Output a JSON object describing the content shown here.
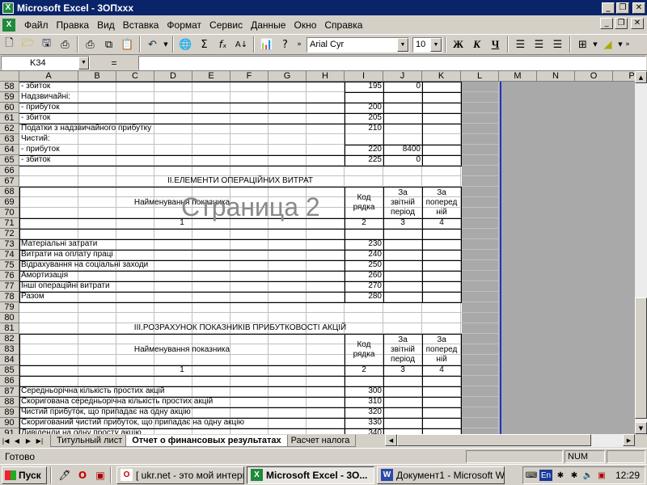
{
  "window": {
    "title": "Microsoft Excel - 3ОПххх"
  },
  "menu": {
    "items": [
      "Файл",
      "Правка",
      "Вид",
      "Вставка",
      "Формат",
      "Сервис",
      "Данные",
      "Окно",
      "Справка"
    ]
  },
  "toolbar": {
    "font_name": "Arial Cyr",
    "font_size": "10",
    "bold_label": "Ж",
    "italic_label": "К",
    "underline_label": "Ч"
  },
  "formula_bar": {
    "cell_ref": "K34",
    "equals": "=",
    "value": ""
  },
  "columns": [
    "A",
    "B",
    "C",
    "D",
    "E",
    "F",
    "G",
    "H",
    "I",
    "J",
    "K",
    "L",
    "M",
    "N",
    "O",
    "P"
  ],
  "rows": [
    "58",
    "59",
    "60",
    "61",
    "62",
    "63",
    "64",
    "65",
    "66",
    "67",
    "68",
    "69",
    "70",
    "71",
    "72",
    "73",
    "74",
    "75",
    "76",
    "77",
    "78",
    "79",
    "80",
    "81",
    "82",
    "83",
    "84",
    "85",
    "86",
    "87",
    "88",
    "89",
    "90",
    "91"
  ],
  "cells": {
    "r58_a": "- збиток",
    "r58_i": "195",
    "r58_j": "0",
    "r59_a": "Надзвичайні:",
    "r60_a": "- прибуток",
    "r60_i": "200",
    "r61_a": "- збиток",
    "r61_i": "205",
    "r62_a": "Податки з надзвичайного прибутку",
    "r62_i": "210",
    "r63_a": "Чистий:",
    "r64_a": "- прибуток",
    "r64_i": "220",
    "r64_j": "8400",
    "r65_a": "- збиток",
    "r65_i": "225",
    "r65_j": "0",
    "section2_title": "II.ЕЛЕМЕНТИ ОПЕРАЦІЙНИХ ВИТРАТ",
    "h1_name": "Найменування показника",
    "h1_code": [
      "Код",
      "рядка"
    ],
    "h1_period": [
      "За",
      "звітній",
      "період"
    ],
    "h1_prev": [
      "За",
      "поперед",
      "ній"
    ],
    "r71_a": "1",
    "r71_i": "2",
    "r71_j": "3",
    "r71_k": "4",
    "r73_a": "Матеріальні затрати",
    "r73_i": "230",
    "r74_a": "Витрати на оплату праці",
    "r74_i": "240",
    "r75_a": "Відрахування на соціальні заходи",
    "r75_i": "250",
    "r76_a": "Амортизація",
    "r76_i": "260",
    "r77_a": "Інші операційні витрати",
    "r77_i": "270",
    "r78_a": "Разом",
    "r78_i": "280",
    "section3_title": "III.РОЗРАХУНОК ПОКАЗНИКІВ ПРИБУТКОВОСТІ АКЦІЙ",
    "h2_name": "Найменування показника",
    "h2_code": [
      "Код",
      "рядка"
    ],
    "h2_period": [
      "За",
      "звітній",
      "період"
    ],
    "h2_prev": [
      "За",
      "поперед",
      "ній"
    ],
    "r85_a": "1",
    "r85_i": "2",
    "r85_j": "3",
    "r85_k": "4",
    "r87_a": "Середньорічна кількість простих акцій",
    "r87_i": "300",
    "r88_a": "Скоригована середньорічна кількість простих акцій",
    "r88_i": "310",
    "r89_a": "Чистий прибуток, що припадає на одну акцію",
    "r89_i": "320",
    "r90_a": "Скоригований чистий прибуток, що припадає на одну акцію",
    "r90_i": "330",
    "r91_a": "Дивіденди на одну просту акцію",
    "r91_i": "340"
  },
  "watermark": "Страница 2",
  "sheet_tabs": [
    "Титульный лист",
    "Отчет о финансовых результатах",
    "Расчет налога"
  ],
  "active_tab": "Отчет о финансовых результатах",
  "status": {
    "text": "Готово",
    "num": "NUM"
  },
  "taskbar": {
    "start_label": "Пуск",
    "tasks": [
      "[ ukr.net - это мой интерн...",
      "Microsoft Excel - 3О...",
      "Документ1 - Microsoft W..."
    ],
    "active_task": "Microsoft Excel - 3О...",
    "lang": "En",
    "clock": "12:29"
  },
  "colors": {
    "title_bar": "#0a246a",
    "page_break": "#2233cc",
    "watermark": "#8a8a8a"
  }
}
